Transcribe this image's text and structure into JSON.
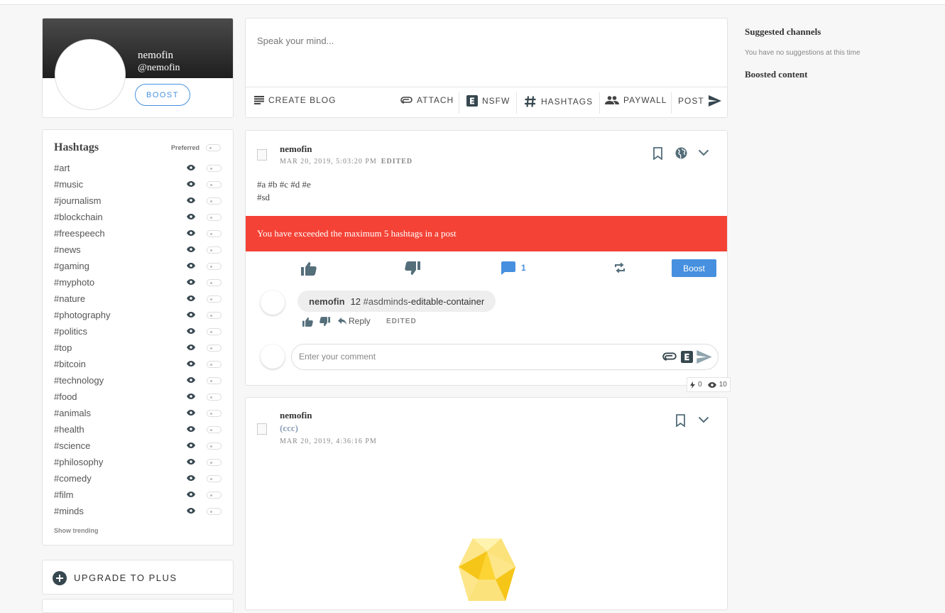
{
  "profile": {
    "name": "nemofin",
    "handle": "@nemofin",
    "boost_label": "BOOST"
  },
  "hashtags": {
    "title": "Hashtags",
    "preferred_label": "Preferred",
    "items": [
      "#art",
      "#music",
      "#journalism",
      "#blockchain",
      "#freespeech",
      "#news",
      "#gaming",
      "#myphoto",
      "#nature",
      "#photography",
      "#politics",
      "#top",
      "#bitcoin",
      "#technology",
      "#food",
      "#animals",
      "#health",
      "#science",
      "#philosophy",
      "#comedy",
      "#film",
      "#minds"
    ],
    "show_trending": "Show trending"
  },
  "upgrade": {
    "label": "UPGRADE TO PLUS"
  },
  "composer": {
    "placeholder": "Speak your mind...",
    "create_blog": "CREATE BLOG",
    "attach": "ATTACH",
    "nsfw": "NSFW",
    "hashtags": "HASHTAGS",
    "paywall": "PAYWALL",
    "post": "POST"
  },
  "post1": {
    "author": "nemofin",
    "date": "MAR 20, 2019, 5:03:20 PM",
    "edited": "EDITED",
    "text_line1": "#a #b #c #d #e",
    "text_line2": "#sd",
    "alert": "You have exceeded the maximum 5 hashtags in a post",
    "comment_count": "1",
    "boost_label": "Boost",
    "comment": {
      "author": "nemofin",
      "text_prefix": "12",
      "hashtag": "#asdminds",
      "text_suffix": "-editable-container",
      "reply_label": "Reply",
      "edited": "EDITED"
    },
    "comment_placeholder": "Enter your comment",
    "stats": {
      "boosts": "0",
      "views": "10"
    }
  },
  "post2": {
    "author": "nemofin",
    "subtitle": "(ccc)",
    "date": "MAR 20, 2019, 4:36:16 PM"
  },
  "sidebar_right": {
    "suggested_title": "Suggested channels",
    "suggested_empty": "You have no suggestions at this time",
    "boosted_title": "Boosted content"
  },
  "colors": {
    "accent": "#4690df",
    "alert": "#f44336",
    "icon": "#546e7a"
  }
}
